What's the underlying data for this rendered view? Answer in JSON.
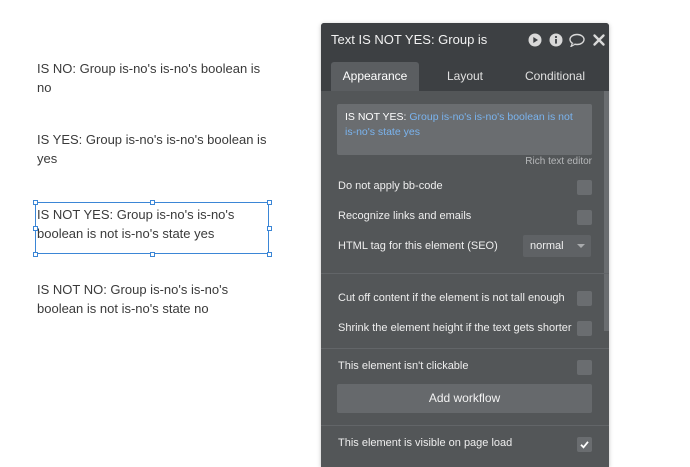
{
  "canvas": {
    "texts": [
      "IS NO: Group is-no's is-no's boolean is no",
      "IS YES: Group is-no's is-no's boolean is yes",
      "IS NOT YES: Group is-no's is-no's boolean is not is-no's state yes",
      "IS NOT NO: Group is-no's is-no's boolean is not is-no's state no"
    ]
  },
  "panel": {
    "title": "Text IS NOT YES: Group is",
    "header_icons": [
      "play-icon",
      "info-icon",
      "comment-icon",
      "close-icon"
    ],
    "tabs": [
      "Appearance",
      "Layout",
      "Conditional"
    ],
    "active_tab": "Appearance",
    "text_content": {
      "prefix": "IS NOT YES: ",
      "expression": "Group is-no's is-no's boolean is not is-no's state yes"
    },
    "rich_text_editor_label": "Rich text editor",
    "options": {
      "no_bbcode": "Do not apply bb-code",
      "recognize_links": "Recognize links and emails",
      "html_tag_label": "HTML tag for this element (SEO)",
      "html_tag_value": "normal",
      "cut_off": "Cut off content if the element is not tall enough",
      "shrink_height": "Shrink the element height if the text gets shorter",
      "not_clickable": "This element isn't clickable",
      "visible_on_load": "This element is visible on page load"
    },
    "add_workflow_label": "Add workflow",
    "colors": {
      "panel_bg": "#535658",
      "header_bg": "#3d4043",
      "expression_blue": "#7ab4ef",
      "selection_blue": "#3b86d6"
    }
  }
}
